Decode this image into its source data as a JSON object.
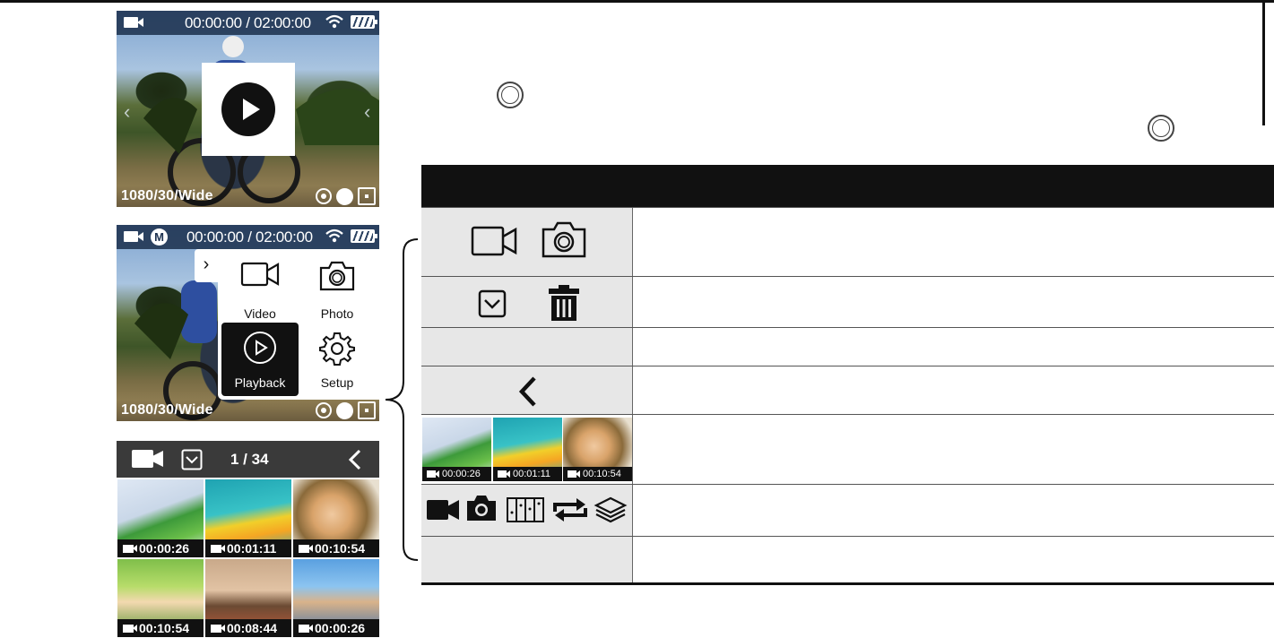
{
  "screen_top": {
    "time": "00:00:00 / 02:00:00",
    "settings": "1080/30/Wide"
  },
  "screen_menu": {
    "mode_badge": "M",
    "time": "00:00:00 / 02:00:00",
    "settings": "1080/30/Wide",
    "items": [
      {
        "label": "Video"
      },
      {
        "label": "Photo"
      },
      {
        "label": "Playback"
      },
      {
        "label": "Setup"
      }
    ]
  },
  "gallery": {
    "counter": "1 / 34",
    "thumbnails": [
      {
        "duration": "00:00:26"
      },
      {
        "duration": "00:01:11"
      },
      {
        "duration": "00:10:54"
      },
      {
        "duration": "00:10:54"
      },
      {
        "duration": "00:08:44"
      },
      {
        "duration": "00:00:26"
      }
    ]
  },
  "table": {
    "header": "",
    "rows": [
      {
        "icons": [
          "video-outline-icon",
          "photo-outline-icon"
        ],
        "description": ""
      },
      {
        "icons": [
          "select-checkbox-icon",
          "trash-icon"
        ],
        "description": ""
      },
      {
        "icons": [],
        "description": ""
      },
      {
        "icons": [
          "back-chevron-icon"
        ],
        "description": ""
      },
      {
        "thumbnails": [
          {
            "duration": "00:00:26"
          },
          {
            "duration": "00:01:11"
          },
          {
            "duration": "00:10:54"
          }
        ],
        "description": ""
      },
      {
        "icons": [
          "video-filled-icon",
          "photo-filled-icon",
          "burst-icon",
          "loop-icon",
          "layers-icon"
        ],
        "description": ""
      },
      {
        "icons": [],
        "description": ""
      }
    ]
  },
  "colors": {
    "status_bar": "#1e3250",
    "gallery_bar": "#3a3a3a",
    "table_header": "#111111",
    "table_icon_cell": "#e7e7e7"
  }
}
